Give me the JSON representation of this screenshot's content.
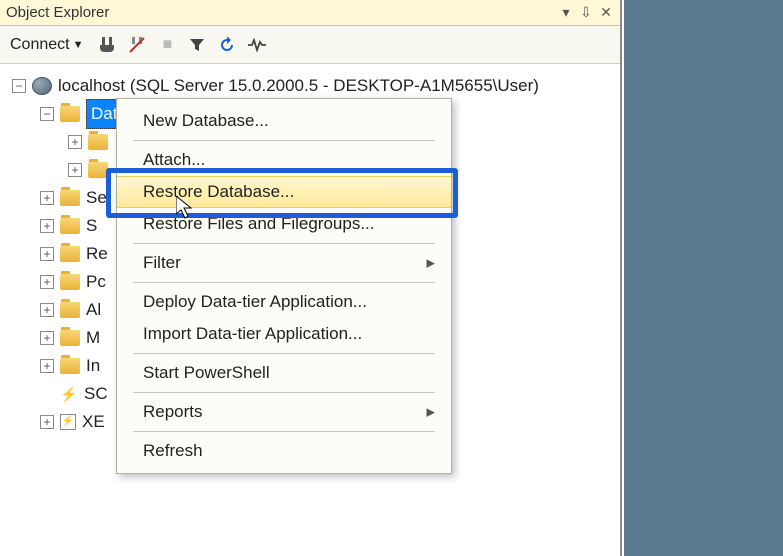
{
  "title_bar": {
    "title": "Object Explorer"
  },
  "toolbar": {
    "connect_label": "Connect"
  },
  "tree": {
    "server_label": "localhost (SQL Server 15.0.2000.5 - DESKTOP-A1M5655\\User)",
    "databases_label": "Databases",
    "truncated_nodes": {
      "n0_label": "Se",
      "n1_label": "S",
      "n2_label": "Re",
      "n3_label": "Pc",
      "n4_label": "Al",
      "n5_label": "M",
      "n6_label": "In",
      "n7_label": "SC",
      "n8_label": "XE"
    }
  },
  "context_menu": {
    "new_database": "New Database...",
    "attach": "Attach...",
    "restore_database": "Restore Database...",
    "restore_files": "Restore Files and Filegroups...",
    "filter": "Filter",
    "deploy_dt": "Deploy Data-tier Application...",
    "import_dt": "Import Data-tier Application...",
    "start_ps": "Start PowerShell",
    "reports": "Reports",
    "refresh": "Refresh"
  }
}
